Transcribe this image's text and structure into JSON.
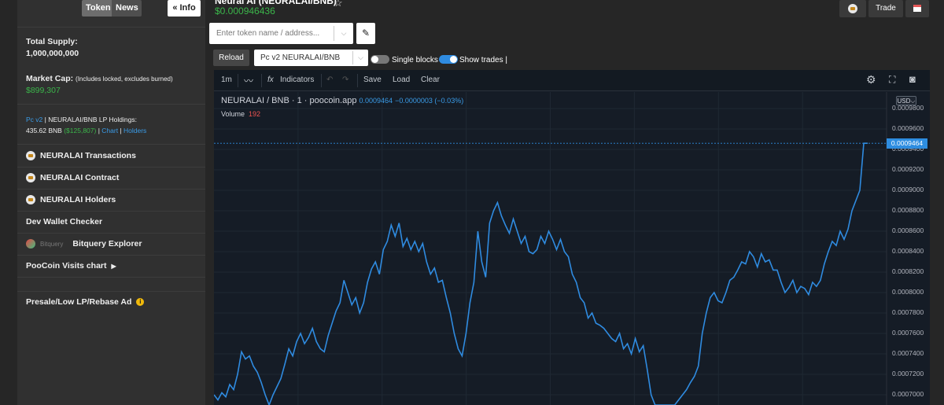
{
  "sidebar": {
    "tabs": {
      "token": "Token",
      "news": "News"
    },
    "info_label": "« Info",
    "total_supply": {
      "label": "Total Supply:",
      "value": "1,000,000,000"
    },
    "market_cap": {
      "label": "Market Cap:",
      "note": "(Includes locked, excludes burned)",
      "value": "$899,307"
    },
    "lp": {
      "dex": "Pc v2",
      "pair_text": " | NEURALAI/BNB LP Holdings:",
      "bnb": "435.62 BNB",
      "usd": "($125,807)",
      "chart": "Chart",
      "holders": "Holders"
    },
    "items": [
      {
        "label": "NEURALAI Transactions",
        "icon": "poocoin-icon"
      },
      {
        "label": "NEURALAI Contract",
        "icon": "poocoin-icon"
      },
      {
        "label": "NEURALAI Holders",
        "icon": "poocoin-icon"
      },
      {
        "label": "Dev Wallet Checker",
        "icon": ""
      },
      {
        "label": "Bitquery Explorer",
        "icon": "bitquery-icon",
        "brand": "Bitquery"
      },
      {
        "label": "PooCoin Visits chart",
        "icon": "caret-right-icon"
      }
    ],
    "ad_label": "Presale/Low LP/Rebase Ad"
  },
  "header": {
    "title": "Neural AI (NEURALAI/BNB)",
    "price": "$0.000946436",
    "search_placeholder": "Enter token name / address...",
    "reload": "Reload",
    "pair_select": "Pc v2 NEURALAI/BNB",
    "single_blocks": "Single blocks",
    "show_trades": "Show trades |",
    "trade": "Trade"
  },
  "chart_toolbar": {
    "interval": "1m",
    "indicators": "Indicators",
    "save": "Save",
    "load": "Load",
    "clear": "Clear"
  },
  "chart_data": {
    "type": "line",
    "symbol": "NEURALAI / BNB",
    "interval": "1",
    "source": "poocoin.app",
    "last": "0.0009464",
    "change": "−0.0000003 (−0.03%)",
    "volume_label": "Volume",
    "volume_value": "192",
    "currency": "USD",
    "last_price_label": "0.0009464",
    "y_ticks": [
      "0.0009800",
      "0.0009600",
      "0.0009400",
      "0.0009200",
      "0.0009000",
      "0.0008800",
      "0.0008600",
      "0.0008400",
      "0.0008200",
      "0.0008000",
      "0.0007800",
      "0.0007600",
      "0.0007400",
      "0.0007200",
      "0.0007000"
    ],
    "ylim": [
      0.00069,
      0.00099
    ],
    "series": [
      {
        "values": [
          0.0007,
          0.000695,
          0.000702,
          0.000698,
          0.00071,
          0.000705,
          0.00072,
          0.000742,
          0.000735,
          0.000738,
          0.000728,
          0.000722,
          0.000712,
          0.0007,
          0.00069,
          0.0007,
          0.000708,
          0.000716,
          0.00073,
          0.000745,
          0.000738,
          0.000752,
          0.00076,
          0.00075,
          0.000756,
          0.000765,
          0.000752,
          0.000745,
          0.000742,
          0.000758,
          0.00077,
          0.000782,
          0.00079,
          0.000812,
          0.0008,
          0.000788,
          0.000795,
          0.00078,
          0.00079,
          0.00081,
          0.000823,
          0.00083,
          0.000818,
          0.000842,
          0.00085,
          0.000866,
          0.000855,
          0.000868,
          0.000845,
          0.000853,
          0.000842,
          0.00085,
          0.00084,
          0.000848,
          0.00083,
          0.000818,
          0.000824,
          0.00081,
          0.000812,
          0.000795,
          0.00078,
          0.00076,
          0.000745,
          0.000738,
          0.00076,
          0.00079,
          0.00081,
          0.00086,
          0.00083,
          0.000815,
          0.000868,
          0.00088,
          0.000888,
          0.000875,
          0.000866,
          0.000858,
          0.000872,
          0.00086,
          0.000848,
          0.000855,
          0.00084,
          0.000838,
          0.000842,
          0.000855,
          0.000848,
          0.00086,
          0.000852,
          0.000842,
          0.000852,
          0.00084,
          0.000835,
          0.000818,
          0.00081,
          0.000795,
          0.00079,
          0.000775,
          0.00078,
          0.00077,
          0.000768,
          0.000765,
          0.00076,
          0.000755,
          0.000752,
          0.00076,
          0.000745,
          0.00075,
          0.00074,
          0.000755,
          0.000742,
          0.000748,
          0.000725,
          0.0007,
          0.00069,
          0.00069,
          0.00069,
          0.00069,
          0.00069,
          0.00069,
          0.000695,
          0.0007,
          0.000705,
          0.000712,
          0.000718,
          0.000728,
          0.00076,
          0.00078,
          0.000795,
          0.0008,
          0.000792,
          0.00079,
          0.0008,
          0.000812,
          0.000815,
          0.000822,
          0.00083,
          0.000828,
          0.00084,
          0.000835,
          0.000825,
          0.000838,
          0.00083,
          0.000832,
          0.000822,
          0.000822,
          0.00081,
          0.0008,
          0.000805,
          0.000812,
          0.0008,
          0.000806,
          0.000804,
          0.000798,
          0.00081,
          0.000806,
          0.000812,
          0.000828,
          0.00084,
          0.00085,
          0.000846,
          0.00086,
          0.000852,
          0.000862,
          0.00088,
          0.00089,
          0.0009,
          0.000946,
          0.000946
        ]
      }
    ]
  }
}
